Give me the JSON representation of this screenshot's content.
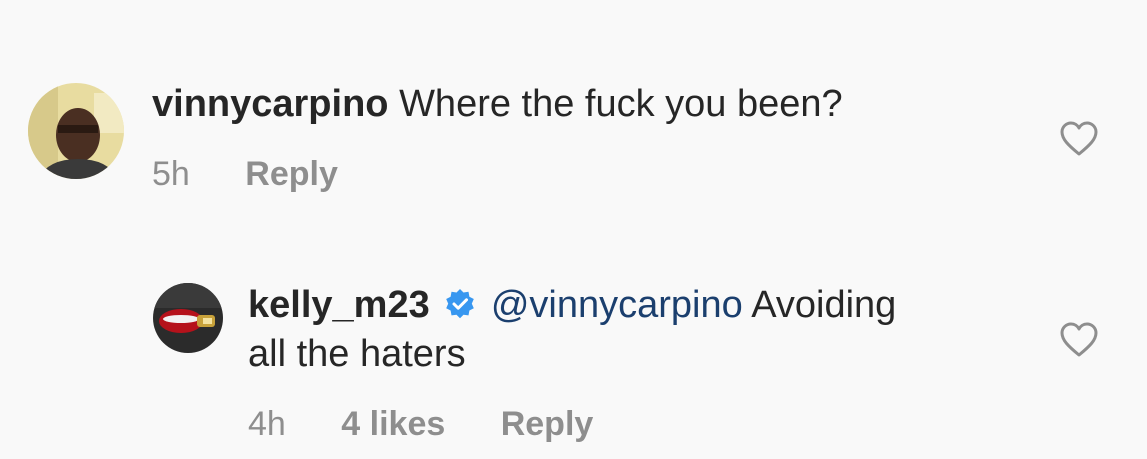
{
  "comments": [
    {
      "username": "vinnycarpino",
      "text": "Where the fuck you been?",
      "time": "5h",
      "reply_label": "Reply"
    },
    {
      "username": "kelly_m23",
      "verified": true,
      "mention": "@vinnycarpino",
      "text_part1": "Avoiding",
      "text_part2": "all the haters",
      "time": "4h",
      "likes": "4 likes",
      "reply_label": "Reply"
    }
  ],
  "icons": {
    "like": "heart-outline-icon",
    "verified": "verified-badge-icon"
  },
  "colors": {
    "background": "#f9f9f9",
    "text": "#262626",
    "muted": "#8e8e8e",
    "mention": "#1b3f6e",
    "verified": "#3897f0"
  }
}
